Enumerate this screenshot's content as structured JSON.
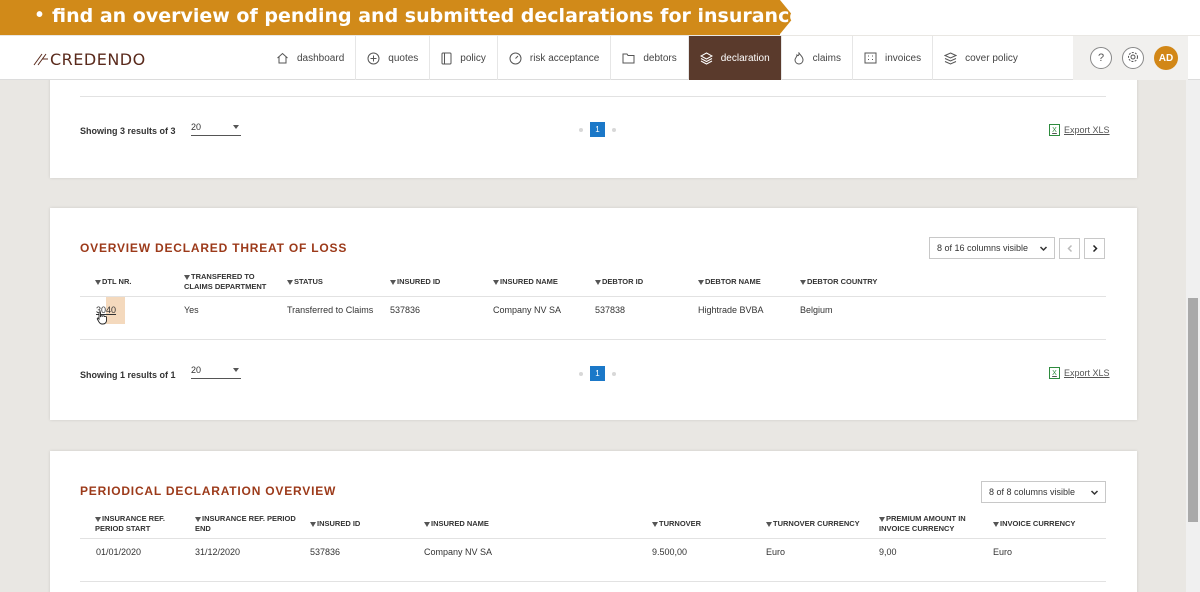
{
  "caption": {
    "text": "find an overview of pending and submitted declarations for insurance",
    "bullet": "•"
  },
  "brand": {
    "logo_text": "CREDENDO",
    "accent": "#d18a19",
    "brown": "#5a3a2c",
    "title_color": "#9c3a1a",
    "page_blue": "#1b78c8"
  },
  "nav": {
    "items": [
      {
        "label": "dashboard",
        "icon": "home-icon"
      },
      {
        "label": "quotes",
        "icon": "plus-circle-icon"
      },
      {
        "label": "policy",
        "icon": "document-icon"
      },
      {
        "label": "risk acceptance",
        "icon": "gauge-icon"
      },
      {
        "label": "debtors",
        "icon": "folder-icon"
      },
      {
        "label": "declaration",
        "icon": "layers-icon",
        "active": true
      },
      {
        "label": "claims",
        "icon": "flame-icon"
      },
      {
        "label": "invoices",
        "icon": "grid-icon"
      },
      {
        "label": "cover policy",
        "icon": "stack-icon"
      }
    ],
    "help_icon": "?",
    "avatar": "AD"
  },
  "card1": {
    "showing": "Showing 3 results of 3",
    "page_size": "20",
    "page": "1",
    "export": "Export XLS"
  },
  "threat": {
    "title": "OVERVIEW DECLARED THREAT OF LOSS",
    "columns_visible": "8 of 16 columns visible",
    "headers": [
      "DTL NR.",
      "TRANSFERED TO CLAIMS DEPARTMENT",
      "STATUS",
      "INSURED ID",
      "INSURED NAME",
      "DEBTOR ID",
      "DEBTOR NAME",
      "DEBTOR COUNTRY"
    ],
    "rows": [
      [
        "3040",
        "Yes",
        "Transferred to Claims",
        "537836",
        "Company NV SA",
        "537838",
        "Hightrade BVBA",
        "Belgium"
      ]
    ],
    "showing": "Showing 1 results of 1",
    "page_size": "20",
    "page": "1",
    "export": "Export XLS"
  },
  "periodical": {
    "title": "PERIODICAL DECLARATION OVERVIEW",
    "columns_visible": "8 of 8 columns visible",
    "headers": [
      "INSURANCE REF. PERIOD START",
      "INSURANCE REF. PERIOD END",
      "INSURED ID",
      "INSURED NAME",
      "TURNOVER",
      "TURNOVER CURRENCY",
      "PREMIUM AMOUNT IN INVOICE CURRENCY",
      "INVOICE CURRENCY"
    ],
    "rows": [
      [
        "01/01/2020",
        "31/12/2020",
        "537836",
        "Company NV SA",
        "9.500,00",
        "Euro",
        "9,00",
        "Euro"
      ]
    ]
  }
}
